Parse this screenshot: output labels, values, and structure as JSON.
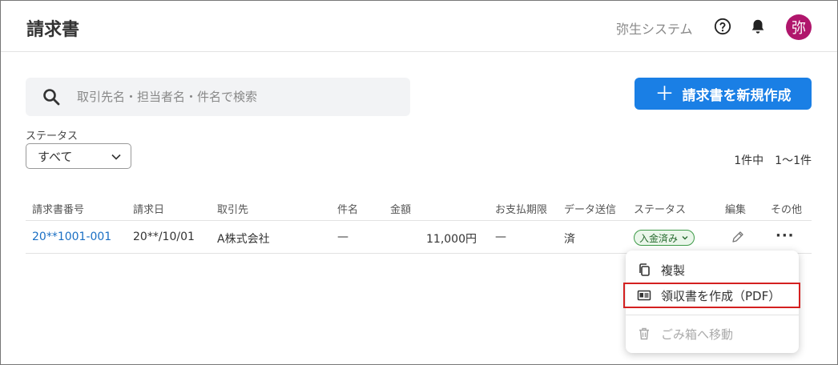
{
  "header": {
    "title": "請求書",
    "company": "弥生システム",
    "avatar_text": "弥"
  },
  "search": {
    "placeholder": "取引先名・担当者名・件名で検索",
    "value": ""
  },
  "new_button": {
    "plus": "＋",
    "label": "請求書を新規作成"
  },
  "filter": {
    "status_label": "ステータス",
    "status_value": "すべて"
  },
  "count": {
    "total": "1件中",
    "range": "1〜1件"
  },
  "table": {
    "headers": [
      "請求書番号",
      "請求日",
      "取引先",
      "件名",
      "金額",
      "お支払期限",
      "データ送信",
      "ステータス",
      "編集",
      "その他"
    ],
    "rows": [
      {
        "number": "20**1001-001",
        "date": "20**/10/01",
        "client": "A株式会社",
        "subject": "—",
        "amount": "11,000円",
        "due": "—",
        "sent": "済",
        "status": "入金済み",
        "more": "···"
      }
    ]
  },
  "menu": {
    "copy": "複製",
    "receipt": "領収書を作成（PDF）",
    "trash": "ごみ箱へ移動"
  },
  "colors": {
    "primary": "#1a7fe5",
    "avatar": "#b0166c",
    "badge_border": "#3d9a47",
    "highlight": "#d42020"
  }
}
